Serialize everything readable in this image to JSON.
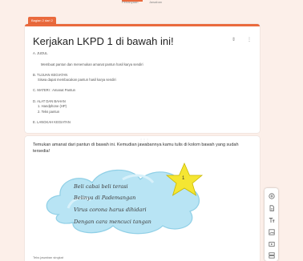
{
  "top_tabs": [
    "Pertanyaan",
    "Jawaban"
  ],
  "section_badge": "Bagian 2 dari 2",
  "form_card": {
    "title": "Kerjakan LKPD 1 di bawah ini!",
    "lines": [
      "A. JUDUL",
      "Membuat pantun dan menemukan amanat pantun hasil karya sendiri",
      "B. TUJUAN KEGIATAN",
      "Siswa dapat membacakan pantun hasil karya sendiri",
      "C. MATERI : Amanat Pantun",
      "D. ALAT DAN BAHAN",
      "1.     Handphone (HP)",
      "2.     Teks pantun",
      "E. LANGKAH KEGIATAN"
    ]
  },
  "question_card": {
    "handle": "⋮⋮⋮",
    "instruction": "Temukan amanat dari pantun di bawah ini. Kemudian jawabannya kamu tulis di kolom bawah yang sudah tersedia!",
    "star_number": "1",
    "pantun_lines": [
      "Beli cabai beli terasi",
      "Belinya di Pademangan",
      "Virus corona harus dihidari",
      "Dengan cara mencuci tangan"
    ],
    "answer_placeholder": "Teks jawaban singkat"
  },
  "toolbar": {
    "tools": [
      "add-question-icon",
      "import-questions-icon",
      "add-title-icon",
      "add-image-icon",
      "add-video-icon",
      "add-section-icon"
    ]
  },
  "colors": {
    "accent": "#ea6a3d",
    "background": "#fcefe9",
    "star": "#f5e632",
    "cloud": "#b8e4f4"
  }
}
